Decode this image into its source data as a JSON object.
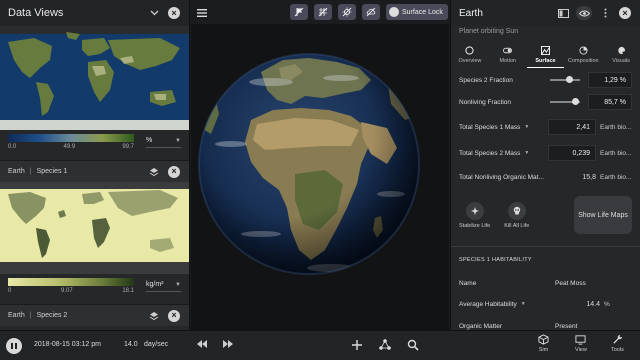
{
  "left_panel": {
    "title": "Data Views",
    "layer1": {
      "colorbar_ticks": [
        "0.0",
        "49.9",
        "99.7"
      ],
      "unit": "%"
    },
    "layer2": {
      "title_planet": "Earth",
      "title_layer": "Species 1",
      "colorbar_ticks": [
        "0",
        "9.07",
        "18.1"
      ],
      "unit": "kg/m²"
    },
    "layer3": {
      "title_planet": "Earth",
      "title_layer": "Species 2"
    }
  },
  "toolbar": {
    "surface_lock_label": "Surface Lock",
    "icons": [
      "eye-off-icon",
      "grid-off-icon",
      "no-sun-icon",
      "no-cloud-icon"
    ]
  },
  "right_panel": {
    "title": "Earth",
    "subtitle": "Planet orbiting Sun",
    "tabs": [
      "Overview",
      "Motion",
      "Surface",
      "Composition",
      "Visuals"
    ],
    "active_tab": "Surface",
    "species2_fraction": {
      "label": "Species 2 Fraction",
      "value": "1,29 %",
      "level": 0.65
    },
    "nonliving_fraction": {
      "label": "Nonliving Fraction",
      "value": "85,7 %",
      "level": 0.857
    },
    "total_species1_mass": {
      "label": "Total Species 1 Mass",
      "value": "2,41",
      "unit": "Earth bio..."
    },
    "total_species2_mass": {
      "label": "Total Species 2 Mass",
      "value": "0,239",
      "unit": "Earth bio..."
    },
    "total_nonliving": {
      "label": "Total Nonliving Organic Mat...",
      "value": "15,8",
      "unit": "Earth bio..."
    },
    "stabilize_label": "Stabilize Life",
    "kill_label": "Kill All Life",
    "show_life_maps_label": "Show Life Maps",
    "habitability_header": "SPECIES 1 HABITABILITY",
    "name_label": "Name",
    "name_value": "Peat Moss",
    "avg_hab_label": "Average Habitability",
    "avg_hab_value": "14.4",
    "avg_hab_unit": "%",
    "organic_label": "Organic Matter",
    "organic_value": "Present"
  },
  "bottom_bar": {
    "datetime": "2018-08-15 03:12 pm",
    "rate": "14.0",
    "rate_unit": "day/sec",
    "sim_label": "Sim",
    "view_label": "View",
    "tools_label": "Tools"
  }
}
